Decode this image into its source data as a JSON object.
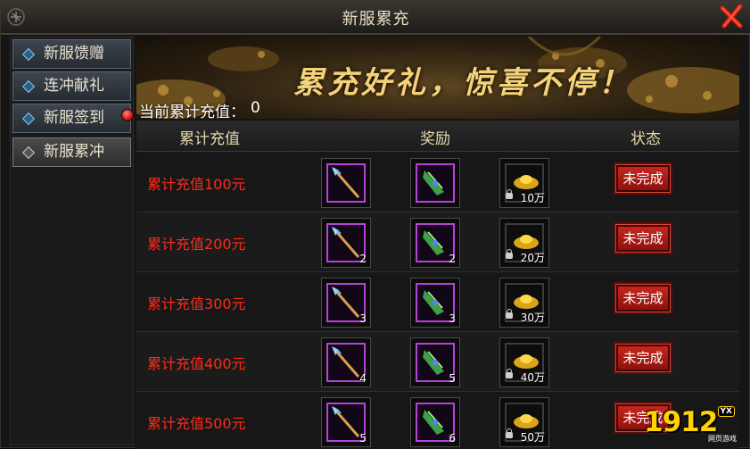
{
  "window": {
    "title": "新服累充"
  },
  "sidebar": {
    "tabs": [
      {
        "label": "新服馈赠"
      },
      {
        "label": "连冲献礼"
      },
      {
        "label": "新服签到"
      },
      {
        "label": "新服累冲"
      }
    ]
  },
  "banner": {
    "slogan": "累充好礼，惊喜不停！"
  },
  "summary": {
    "label": "当前累计充值：",
    "value": "0"
  },
  "table": {
    "headers": [
      "累计充值",
      "奖励",
      "状态"
    ],
    "rows": [
      {
        "label": "累计充值100元",
        "item1_qty": "",
        "item2_qty": "",
        "gold": "10万",
        "status": "未完成"
      },
      {
        "label": "累计充值200元",
        "item1_qty": "2",
        "item2_qty": "2",
        "gold": "20万",
        "status": "未完成"
      },
      {
        "label": "累计充值300元",
        "item1_qty": "3",
        "item2_qty": "3",
        "gold": "30万",
        "status": "未完成"
      },
      {
        "label": "累计充值400元",
        "item1_qty": "4",
        "item2_qty": "5",
        "gold": "40万",
        "status": "未完成"
      },
      {
        "label": "累计充值500元",
        "item1_qty": "5",
        "item2_qty": "6",
        "gold": "50万",
        "status": "未完成"
      }
    ]
  },
  "watermark": {
    "logo": "1912",
    "badge": "YX",
    "sub": "网页游戏"
  },
  "colors": {
    "accent_red": "#ff2a1a",
    "frame_purple": "#b642d8",
    "gold": "#f3d27a"
  },
  "icons": {
    "item1": "spear-icon",
    "item2": "green-shard-icon",
    "item3": "gold-ingot-icon",
    "close": "close-x-icon"
  }
}
